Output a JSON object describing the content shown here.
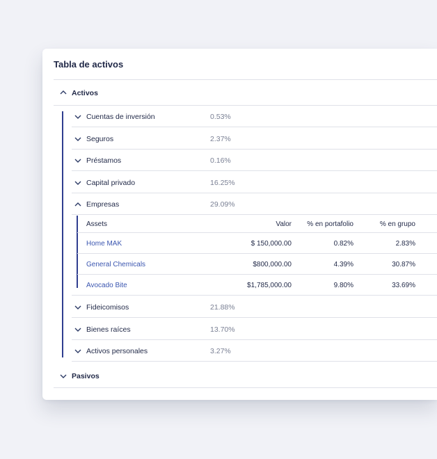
{
  "card": {
    "title": "Tabla de activos"
  },
  "activos": {
    "label": "Activos",
    "rows_top": [
      {
        "label": "Cuentas de inversión",
        "pct": "0.53%"
      },
      {
        "label": "Seguros",
        "pct": "2.37%"
      },
      {
        "label": "Préstamos",
        "pct": "0.16%"
      },
      {
        "label": "Capital privado",
        "pct": "16.25%"
      }
    ],
    "empresas": {
      "label": "Empresas",
      "pct": "29.09%",
      "headers": {
        "assets": "Assets",
        "valor": "Valor",
        "portfolio": "% en portafolio",
        "grupo": "% en grupo"
      },
      "items": [
        {
          "asset": "Home MAK",
          "valor": "$ 150,000.00",
          "portfolio": "0.82%",
          "grupo": "2.83%"
        },
        {
          "asset": "General Chemicals",
          "valor": "$800,000.00",
          "portfolio": "4.39%",
          "grupo": "30.87%"
        },
        {
          "asset": "Avocado Bite",
          "valor": "$1,785,000.00",
          "portfolio": "9.80%",
          "grupo": "33.69%"
        }
      ]
    },
    "rows_bottom": [
      {
        "label": "Fideicomisos",
        "pct": "21.88%"
      },
      {
        "label": "Bienes raíces",
        "pct": "13.70%"
      },
      {
        "label": "Activos personales",
        "pct": "3.27%"
      }
    ]
  },
  "pasivos": {
    "label": "Pasivos"
  },
  "icons": {
    "collapse": "chevron-up-icon",
    "expand": "chevron-down-icon"
  },
  "colors": {
    "accent": "#2f3e8f",
    "link": "#3b56b0",
    "background": "#f1f2f7"
  }
}
